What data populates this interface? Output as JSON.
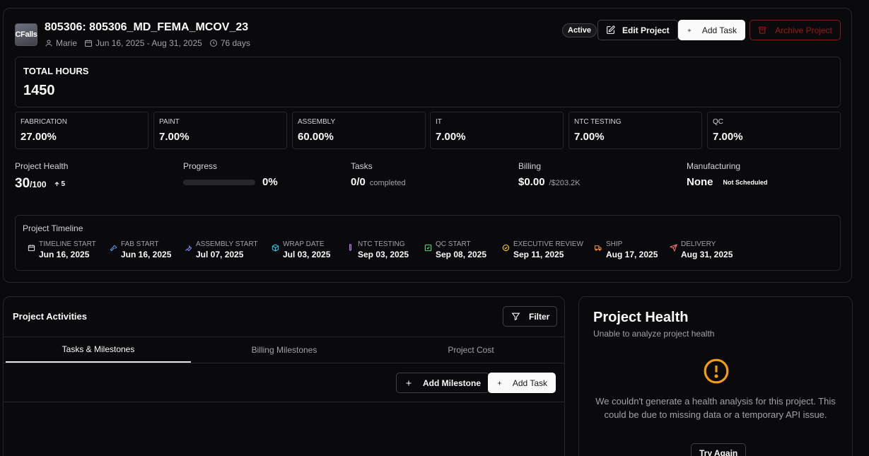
{
  "project": {
    "logo_text": "CFalls",
    "title": "805306: 805306_MD_FEMA_MCOV_23",
    "owner": "Marie",
    "date_range": "Jun 16, 2025 - Aug 31, 2025",
    "duration": "76 days",
    "status": "Active"
  },
  "actions": {
    "edit": "Edit Project",
    "add_task": "Add Task",
    "archive": "Archive Project"
  },
  "hours": {
    "label": "TOTAL HOURS",
    "value": "1450"
  },
  "departments": [
    {
      "label": "FABRICATION",
      "value": "27.00%"
    },
    {
      "label": "PAINT",
      "value": "7.00%"
    },
    {
      "label": "ASSEMBLY",
      "value": "60.00%"
    },
    {
      "label": "IT",
      "value": "7.00%"
    },
    {
      "label": "NTC TESTING",
      "value": "7.00%"
    },
    {
      "label": "QC",
      "value": "7.00%"
    }
  ],
  "stats": {
    "health": {
      "label": "Project Health",
      "value": "30",
      "max": "/100",
      "delta": "5"
    },
    "progress": {
      "label": "Progress",
      "value": "0%",
      "fraction": 0
    },
    "tasks": {
      "label": "Tasks",
      "value": "0/0",
      "suffix": "completed"
    },
    "billing": {
      "label": "Billing",
      "value": "$0.00",
      "total": "/$203.2K"
    },
    "manufacturing": {
      "label": "Manufacturing",
      "value": "None",
      "status": "Not Scheduled"
    }
  },
  "timeline": {
    "title": "Project Timeline",
    "milestones": [
      {
        "label": "TIMELINE START",
        "date": "Jun 16, 2025",
        "icon": "calendar-icon",
        "color": "#e4e4e7"
      },
      {
        "label": "FAB START",
        "date": "Jun 16, 2025",
        "icon": "hammer-icon",
        "color": "#60a5fa"
      },
      {
        "label": "ASSEMBLY START",
        "date": "Jul 07, 2025",
        "icon": "wrench-icon",
        "color": "#818cf8"
      },
      {
        "label": "WRAP DATE",
        "date": "Jul 03, 2025",
        "icon": "package-icon",
        "color": "#22d3ee"
      },
      {
        "label": "NTC TESTING",
        "date": "Sep 03, 2025",
        "icon": "test-tube-icon",
        "color": "#c084fc"
      },
      {
        "label": "QC START",
        "date": "Sep 08, 2025",
        "icon": "check-square-icon",
        "color": "#4ade80"
      },
      {
        "label": "EXECUTIVE REVIEW",
        "date": "Sep 11, 2025",
        "icon": "check-circle-icon",
        "color": "#facc15"
      },
      {
        "label": "SHIP",
        "date": "Aug 17, 2025",
        "icon": "truck-icon",
        "color": "#fb923c"
      },
      {
        "label": "DELIVERY",
        "date": "Aug 31, 2025",
        "icon": "send-icon",
        "color": "#f87171"
      }
    ]
  },
  "activities": {
    "title": "Project Activities",
    "filter": "Filter",
    "tabs": [
      "Tasks & Milestones",
      "Billing Milestones",
      "Project Cost"
    ],
    "add_milestone": "Add Milestone",
    "add_task": "Add Task"
  },
  "health_panel": {
    "title": "Project Health",
    "subtitle": "Unable to analyze project health",
    "message": "We couldn't generate a health analysis for this project. This could be due to missing data or a temporary API issue.",
    "retry": "Try Again",
    "warning_color": "#f59e0b"
  }
}
